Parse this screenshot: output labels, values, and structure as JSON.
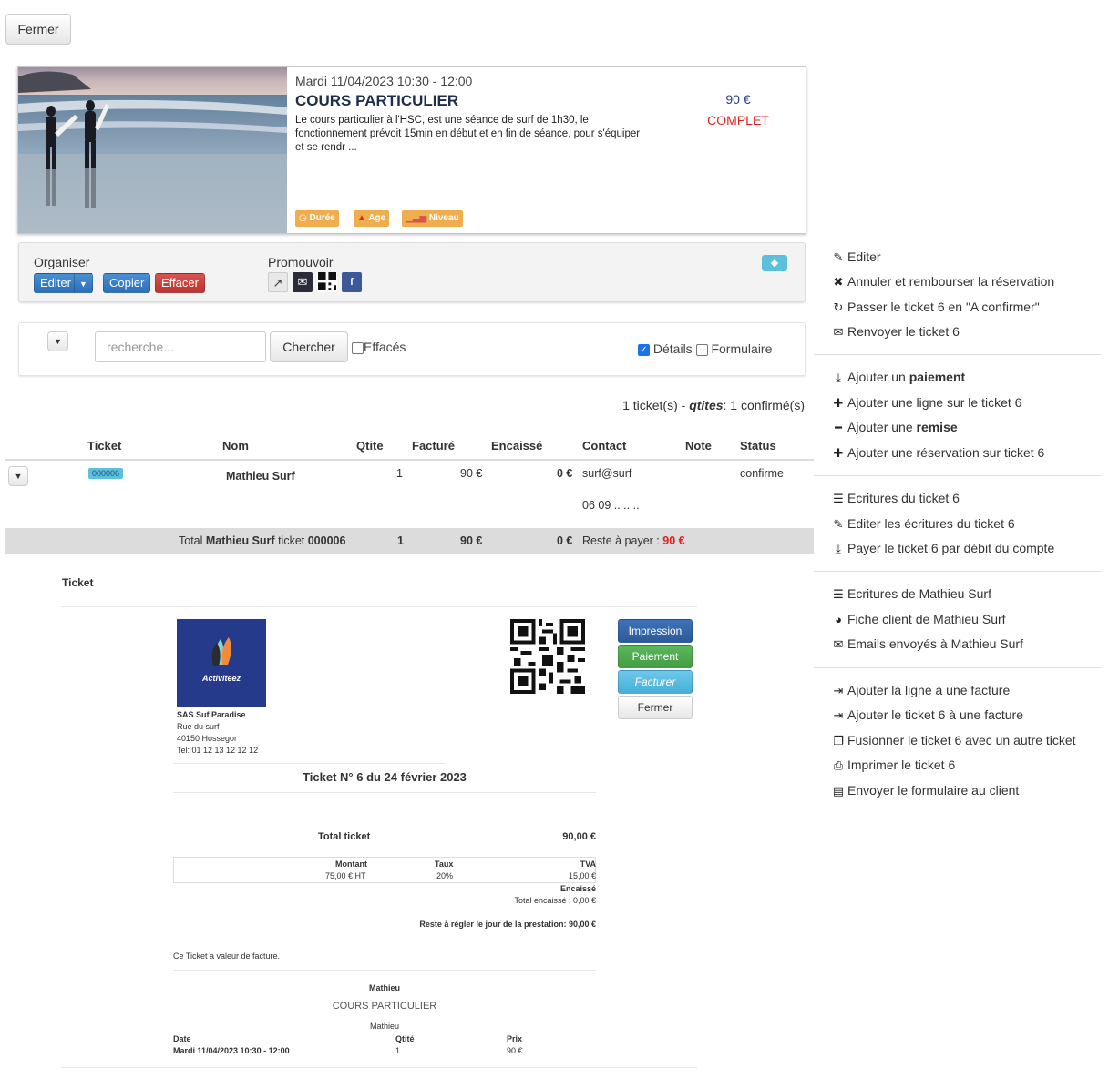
{
  "top": {
    "close_label": "Fermer"
  },
  "event": {
    "date": "Mardi 11/04/2023 10:30 - 12:00",
    "title": "COURS PARTICULIER",
    "description": "Le cours particulier à l'HSC, est une séance de surf de 1h30, le fonctionnement prévoit 15min en début et en fin de séance, pour s'équiper et se rendr ...",
    "price": "90 €",
    "status": "COMPLET",
    "tags": [
      "Durée",
      "Age",
      "Niveau"
    ]
  },
  "organiser": {
    "title": "Organiser",
    "edit": "Editer",
    "copy": "Copier",
    "delete": "Effacer",
    "promote_title": "Promouvoir"
  },
  "search": {
    "placeholder": "recherche...",
    "button": "Chercher",
    "deleted_label": "Effacés",
    "details_label": "Détails",
    "form_label": "Formulaire"
  },
  "summary": {
    "prefix": "1 ticket(s) - ",
    "qtites": "qtites",
    "suffix": ": 1 confirmé(s)"
  },
  "table": {
    "headers": [
      "Ticket",
      "Nom",
      "Qtite",
      "Facturé",
      "Encaissé",
      "Contact",
      "Note",
      "Status"
    ],
    "row": {
      "ticket": "000006",
      "name": "Mathieu Surf",
      "qty": "1",
      "billed": "90 €",
      "cashed": "0 €",
      "email": "surf@surf",
      "phone": "06 09 .. .. ..",
      "status": "confirme"
    },
    "total": {
      "label_pre": "Total ",
      "name": "Mathieu Surf",
      "label_mid": " ticket ",
      "ticket": "000006",
      "qty": "1",
      "billed": "90 €",
      "cashed": "0 €",
      "remaining_label": "Reste à payer : ",
      "remaining": "90 €"
    }
  },
  "document": {
    "section_label": "Ticket",
    "logo_text": "Activiteez",
    "company": "SAS Suf Paradise",
    "address1": "Rue du surf",
    "address2": "40150 Hossegor",
    "phone": "Tel: 01 12 13 12 12 12",
    "buttons": [
      "Impression",
      "Paiement",
      "Facturer",
      "Fermer"
    ],
    "heading": "Ticket N° 6 du 24 février 2023",
    "total_label": "Total ticket",
    "total_value": "90,00 €",
    "tax_headers": [
      "Montant",
      "Taux",
      "TVA"
    ],
    "tax_values": [
      "75,00 € HT",
      "20%",
      "15,00 €"
    ],
    "encaisse_label": "Encaissé",
    "total_encaisse": "Total encaissé : 0,00 €",
    "reste": "Reste à régler le jour de la prestation: 90,00 €",
    "note": "Ce Ticket a valeur de facture.",
    "customer": "Mathieu",
    "product": "COURS PARTICULIER",
    "participant": "Mathieu",
    "line_headers": [
      "Date",
      "Qtité",
      "Prix"
    ],
    "line_values": [
      "Mardi 11/04/2023 10:30 - 12:00",
      "1",
      "90 €"
    ]
  },
  "menu": {
    "group1": [
      {
        "icon": "pencil-icon",
        "label": "Editer"
      },
      {
        "icon": "cross-icon",
        "label": "Annuler et rembourser la réservation"
      },
      {
        "icon": "refresh-icon",
        "label": "Passer le ticket 6 en \"A confirmer\""
      },
      {
        "icon": "envelope-icon",
        "label": "Renvoyer le ticket 6"
      }
    ],
    "group2": [
      {
        "icon": "download-icon",
        "pre": "Ajouter un ",
        "bold": "paiement"
      },
      {
        "icon": "plus-icon",
        "label": "Ajouter une ligne sur le ticket 6"
      },
      {
        "icon": "minus-icon",
        "pre": "Ajouter une ",
        "bold": "remise"
      },
      {
        "icon": "plus-icon",
        "label": "Ajouter une réservation sur ticket 6"
      }
    ],
    "group3": [
      {
        "icon": "list-icon",
        "label": "Ecritures du ticket 6"
      },
      {
        "icon": "pencil-icon",
        "label": "Editer les écritures du ticket 6"
      },
      {
        "icon": "download-icon",
        "label": "Payer le ticket 6 par débit du compte"
      }
    ],
    "group4": [
      {
        "icon": "list-icon",
        "label": "Ecritures de Mathieu Surf"
      },
      {
        "icon": "user-icon",
        "label": "Fiche client de Mathieu Surf"
      },
      {
        "icon": "envelope-icon",
        "label": "Emails envoyés à Mathieu Surf"
      }
    ],
    "group5": [
      {
        "icon": "login-icon",
        "label": "Ajouter la ligne à une facture"
      },
      {
        "icon": "login-icon",
        "label": "Ajouter le ticket 6 à une facture"
      },
      {
        "icon": "merge-icon",
        "label": "Fusionner le ticket 6 avec un autre ticket"
      },
      {
        "icon": "print-icon",
        "label": "Imprimer le ticket 6"
      },
      {
        "icon": "form-icon",
        "label": "Envoyer le formulaire au client"
      }
    ]
  }
}
